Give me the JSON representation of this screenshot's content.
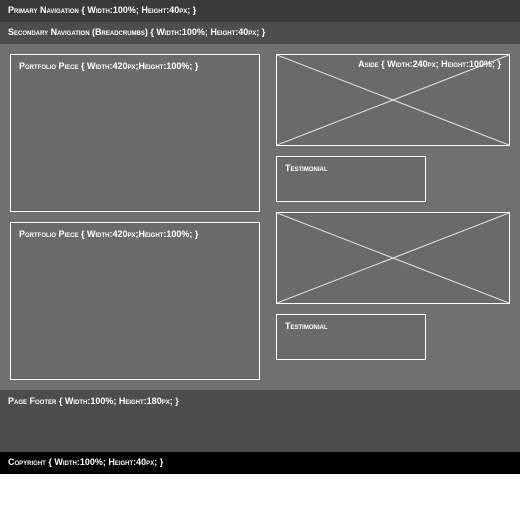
{
  "primary_nav": "Primary Navigation { Width:100%; Height:40px; }",
  "breadcrumb": "Secondary Navigation (Breadcrumbs) { Width:100%; Height:40px; }",
  "portfolio": [
    "Portfolio Piece { Width:420px;Height:100%; }",
    "Portfolio Piece { Width:420px;Height:100%; }"
  ],
  "aside": "Aside { Width:240px; Height:100%; }",
  "testimonial": [
    "Testimonial",
    "Testimonial"
  ],
  "footer": "Page Footer { Width:100%; Height:180px; }",
  "copyright": "Copyright { Width:100%; Height:40px; }"
}
